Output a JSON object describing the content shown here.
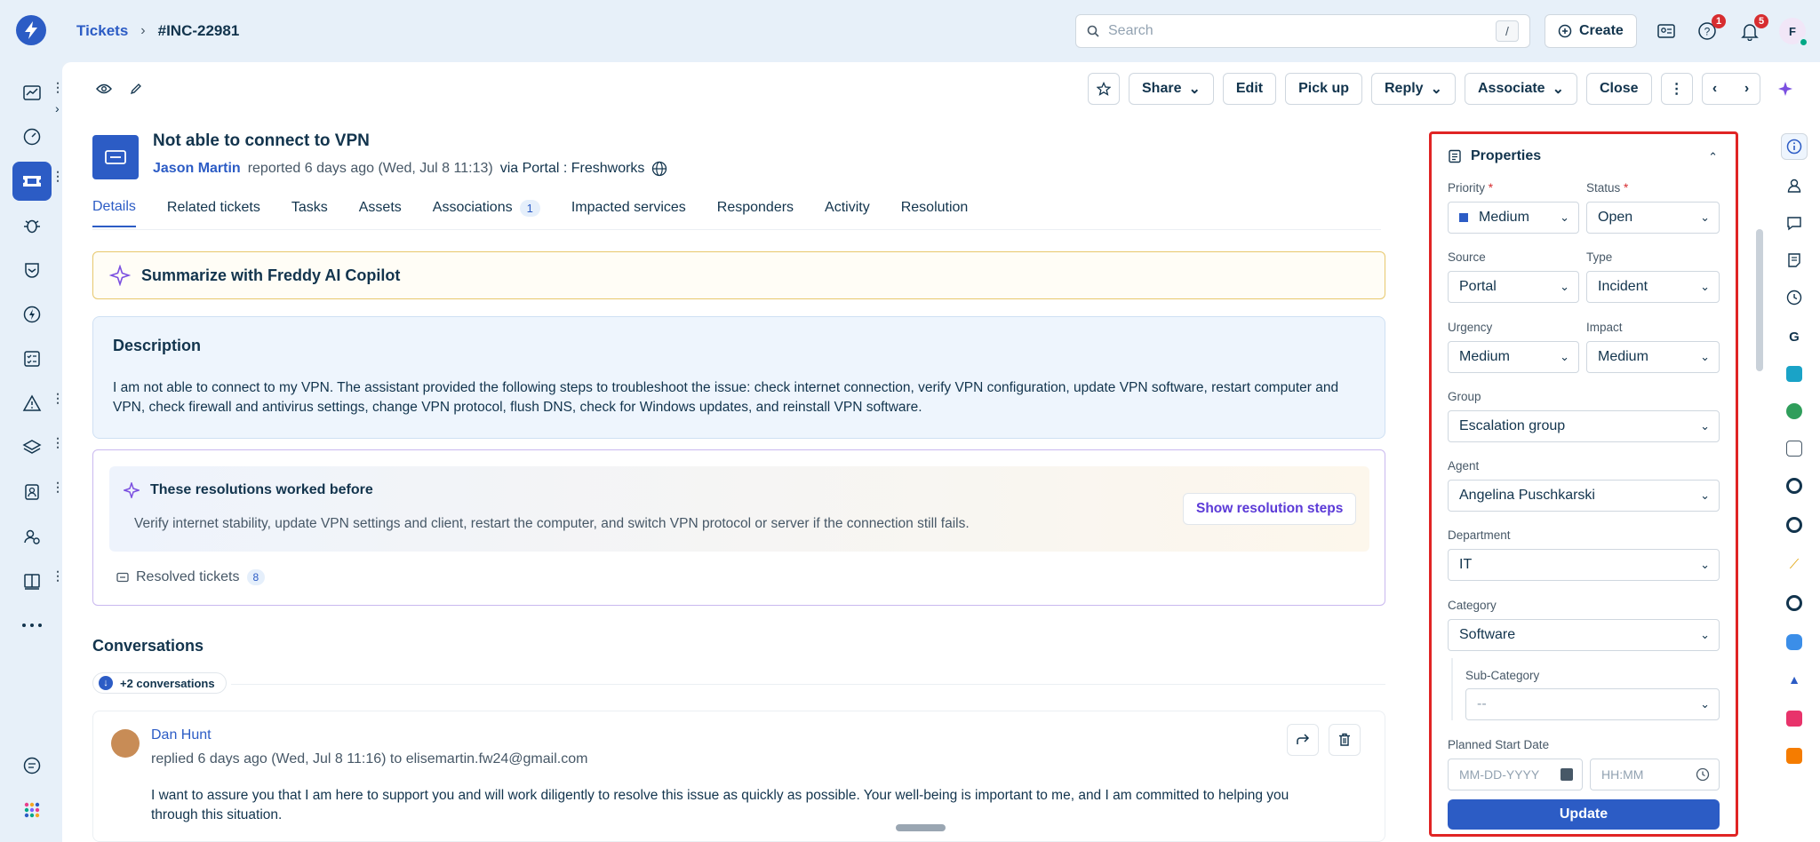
{
  "header": {
    "breadcrumb_root": "Tickets",
    "breadcrumb_sep": "›",
    "ticket_id": "#INC-22981",
    "search_placeholder": "Search",
    "search_shortcut": "/",
    "create_label": "Create",
    "help_badge": "1",
    "notif_badge": "5",
    "avatar_initial": "F"
  },
  "actions": {
    "share": "Share",
    "edit": "Edit",
    "pickup": "Pick up",
    "reply": "Reply",
    "associate": "Associate",
    "close": "Close"
  },
  "ticket": {
    "title": "Not able to connect to VPN",
    "requester": "Jason Martin",
    "reported": "reported 6 days ago (Wed, Jul 8 11:13)",
    "via": "via Portal : Freshworks"
  },
  "tabs": [
    {
      "label": "Details"
    },
    {
      "label": "Related tickets"
    },
    {
      "label": "Tasks"
    },
    {
      "label": "Assets"
    },
    {
      "label": "Associations",
      "count": "1"
    },
    {
      "label": "Impacted services"
    },
    {
      "label": "Responders"
    },
    {
      "label": "Activity"
    },
    {
      "label": "Resolution"
    }
  ],
  "freddy": {
    "label": "Summarize with Freddy AI Copilot"
  },
  "description": {
    "title": "Description",
    "body": "I am not able to connect to my VPN. The assistant provided the following steps to troubleshoot the issue: check internet connection, verify VPN configuration, update VPN software, restart computer and VPN, check firewall and antivirus settings, change VPN protocol, flush DNS, check for Windows updates, and reinstall VPN software."
  },
  "resolutions": {
    "title": "These resolutions worked before",
    "body": "Verify internet stability, update VPN settings and client, restart the computer, and switch VPN protocol or server if the connection still fails.",
    "show_steps": "Show resolution steps",
    "resolved_label": "Resolved tickets",
    "resolved_count": "8"
  },
  "conversations": {
    "title": "Conversations",
    "more": "+2 conversations",
    "item": {
      "author": "Dan Hunt",
      "meta": "replied 6 days ago (Wed, Jul 8 11:16) to elisemartin.fw24@gmail.com",
      "text": "I want to assure you that I am here to support you and will work diligently to resolve this issue as quickly as possible. Your well-being is important to me, and I am committed to helping you through this situation."
    }
  },
  "properties": {
    "title": "Properties",
    "priority_label": "Priority",
    "priority_value": "Medium",
    "status_label": "Status",
    "status_value": "Open",
    "required_mark": "*",
    "source_label": "Source",
    "source_value": "Portal",
    "type_label": "Type",
    "type_value": "Incident",
    "urgency_label": "Urgency",
    "urgency_value": "Medium",
    "impact_label": "Impact",
    "impact_value": "Medium",
    "group_label": "Group",
    "group_value": "Escalation group",
    "agent_label": "Agent",
    "agent_value": "Angelina Puschkarski",
    "department_label": "Department",
    "department_value": "IT",
    "category_label": "Category",
    "category_value": "Software",
    "subcategory_label": "Sub-Category",
    "subcategory_value": "--",
    "planned_start_label": "Planned Start Date",
    "date_placeholder": "MM-DD-YYYY",
    "time_placeholder": "HH:MM",
    "update_label": "Update"
  },
  "colors": {
    "accent": "#2c5cc5",
    "highlight_border": "#e02424",
    "badge": "#d72d30"
  }
}
